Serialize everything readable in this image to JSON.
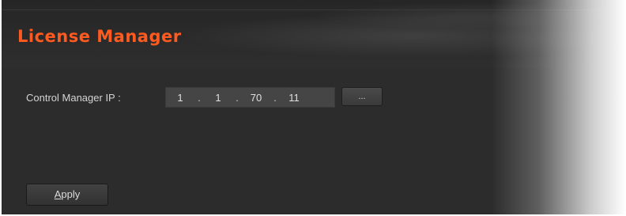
{
  "window": {
    "title": "License Manager",
    "accent_color": "#ff5a1f"
  },
  "form": {
    "ip_label": "Control Manager IP :",
    "ip_octets": [
      "1",
      "1",
      "70",
      "11"
    ],
    "ip_separator": ".",
    "browse_label": "...",
    "apply_label_mnemonic": "A",
    "apply_label_rest": "pply"
  }
}
